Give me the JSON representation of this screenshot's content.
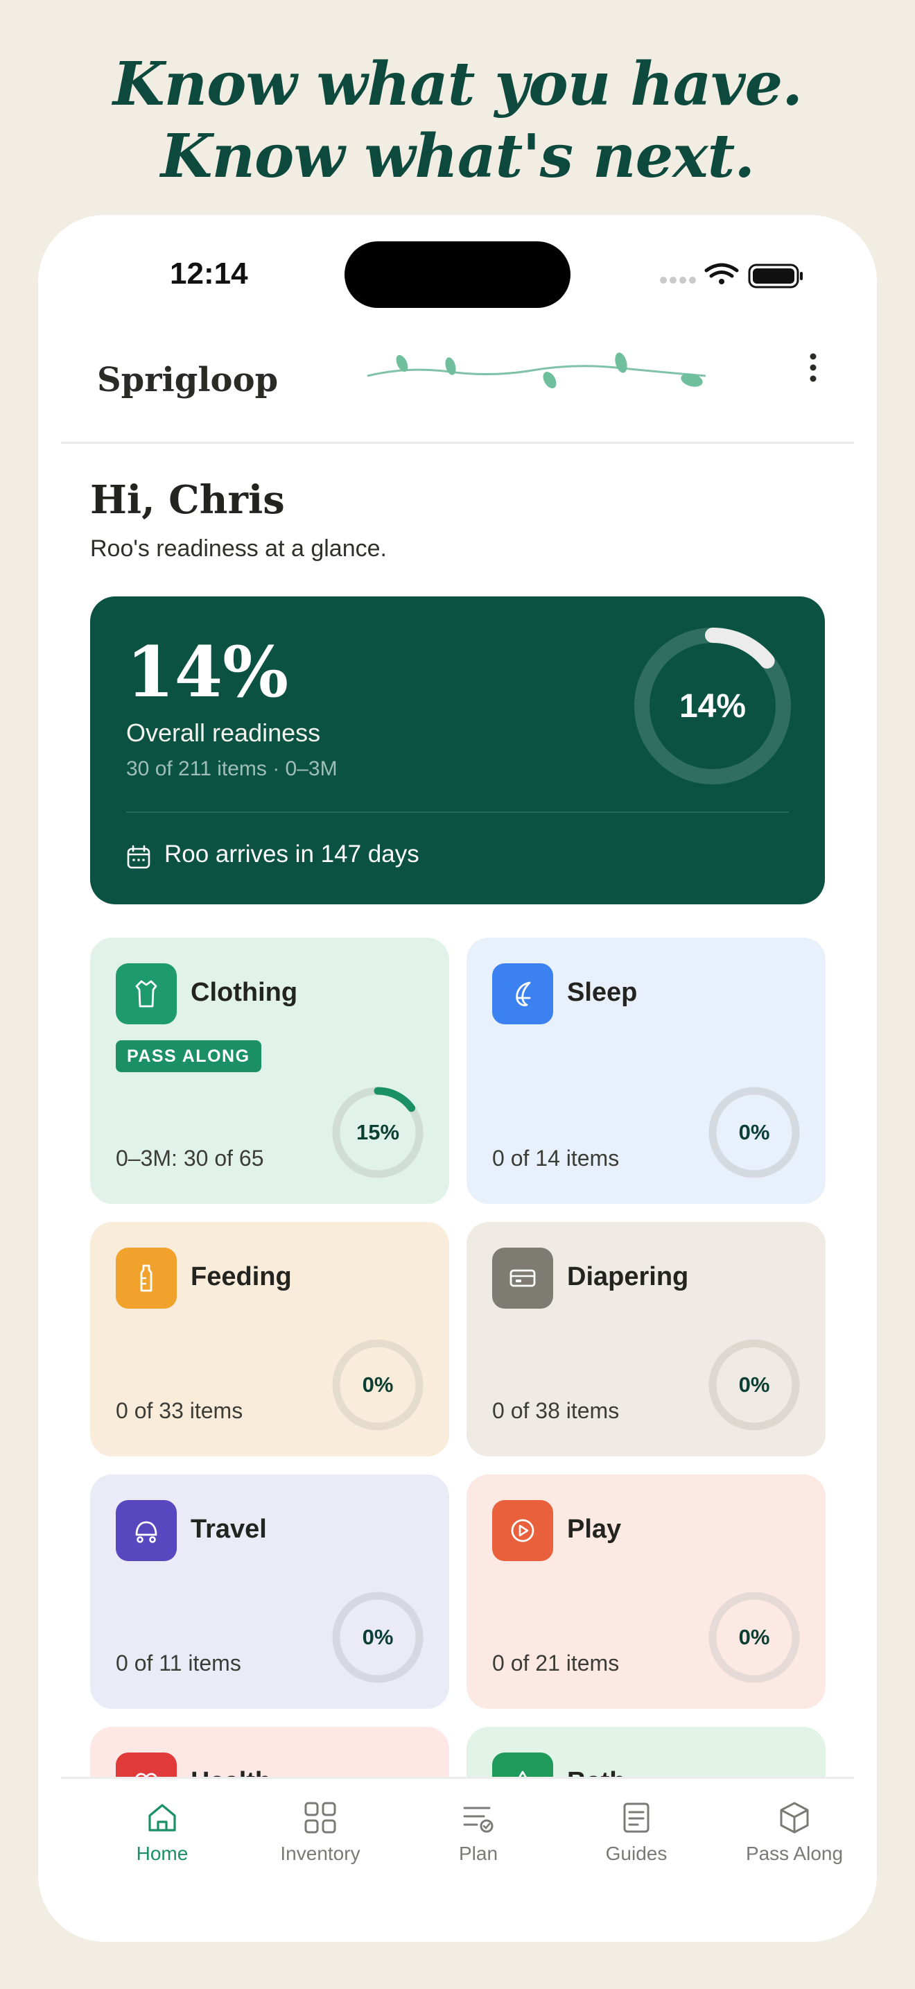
{
  "headline": {
    "line1": "Know what you have.",
    "line2": "Know what's next."
  },
  "status_bar": {
    "time": "12:14",
    "icons": [
      "signal-icon",
      "wifi-icon",
      "battery-icon"
    ]
  },
  "app": {
    "brand": "Sprigloop",
    "menu_icon": "more-vertical-icon"
  },
  "greeting": {
    "title": "Hi, Chris",
    "subtitle": "Roo's readiness at a glance."
  },
  "readiness": {
    "percent_label": "14%",
    "percent_value": 14,
    "label": "Overall readiness",
    "meta": "30 of 211 items · 0–3M",
    "arrival": "Roo arrives in 147 days",
    "arrival_icon": "calendar-icon"
  },
  "categories": [
    {
      "name": "Clothing",
      "icon": "shirt-icon",
      "icon_color": "#1e9a6c",
      "badge": "PASS ALONG",
      "count": "0–3M: 30 of 65",
      "percent_label": "15%",
      "percent_value": 15
    },
    {
      "name": "Sleep",
      "icon": "moon-icon",
      "icon_color": "#3b82f0",
      "count": "0 of 14 items",
      "percent_label": "0%",
      "percent_value": 0
    },
    {
      "name": "Feeding",
      "icon": "bottle-icon",
      "icon_color": "#f0a22c",
      "count": "0 of 33 items",
      "percent_label": "0%",
      "percent_value": 0
    },
    {
      "name": "Diapering",
      "icon": "diaper-icon",
      "icon_color": "#7d7b72",
      "count": "0 of 38 items",
      "percent_label": "0%",
      "percent_value": 0
    },
    {
      "name": "Travel",
      "icon": "stroller-icon",
      "icon_color": "#5748c0",
      "count": "0 of 11 items",
      "percent_label": "0%",
      "percent_value": 0
    },
    {
      "name": "Play",
      "icon": "play-icon",
      "icon_color": "#e8603c",
      "count": "0 of 21 items",
      "percent_label": "0%",
      "percent_value": 0
    },
    {
      "name": "Health",
      "icon": "heart-icon",
      "icon_color": "#e03a3a"
    },
    {
      "name": "Bath",
      "icon": "drop-icon",
      "icon_color": "#1f9a5a"
    }
  ],
  "tabs": [
    {
      "label": "Home",
      "icon": "home-icon",
      "active": true
    },
    {
      "label": "Inventory",
      "icon": "grid-icon",
      "active": false
    },
    {
      "label": "Plan",
      "icon": "checklist-icon",
      "active": false
    },
    {
      "label": "Guides",
      "icon": "document-icon",
      "active": false
    },
    {
      "label": "Pass Along",
      "icon": "box-icon",
      "active": false
    }
  ],
  "colors": {
    "accent": "#1b8f66",
    "readiness_bg": "#0b5243",
    "headline": "#0d4a3d",
    "page_bg": "#f1ede3"
  }
}
